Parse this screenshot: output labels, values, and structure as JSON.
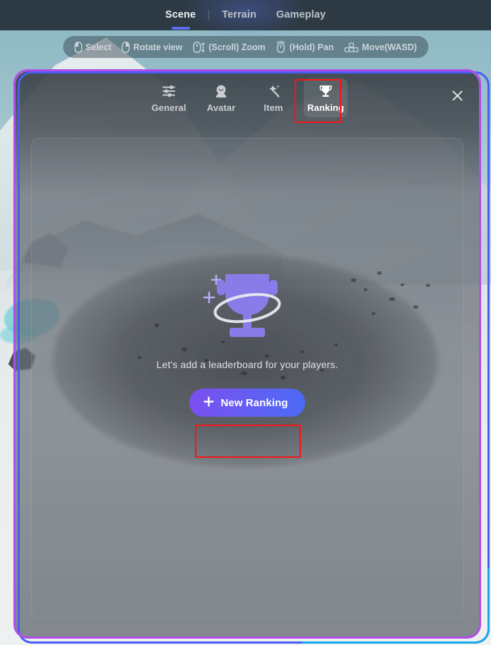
{
  "topnav": {
    "tabs": [
      {
        "label": "Scene",
        "active": true
      },
      {
        "label": "Terrain",
        "active": false
      },
      {
        "label": "Gameplay",
        "active": false
      }
    ],
    "highlighted_tab": "Gameplay"
  },
  "viewport_hints": [
    {
      "icon": "mouse-left-click-icon",
      "label": "Select"
    },
    {
      "icon": "mouse-right-click-icon",
      "label": "Rotate view"
    },
    {
      "icon": "mouse-scroll-icon",
      "label": "(Scroll) Zoom"
    },
    {
      "icon": "mouse-middle-hold-icon",
      "label": "(Hold) Pan"
    },
    {
      "icon": "wasd-keys-icon",
      "label": "Move(WASD)"
    }
  ],
  "modal": {
    "tabs": [
      {
        "label": "General",
        "icon": "sliders-icon",
        "selected": false
      },
      {
        "label": "Avatar",
        "icon": "avatar-head-icon",
        "selected": false
      },
      {
        "label": "Item",
        "icon": "magic-wand-star-icon",
        "selected": false
      },
      {
        "label": "Ranking",
        "icon": "trophy-icon",
        "selected": true
      }
    ],
    "selected_tab": "Ranking",
    "close_icon": "close-icon",
    "empty_state": {
      "illustration": "trophy-sparkle-icon",
      "message": "Let's add a leaderboard for your players.",
      "cta_icon": "plus-icon",
      "cta_label": "New Ranking"
    }
  },
  "colors": {
    "accent_blue": "#5b6ceb",
    "button_gradient_start": "#7b4ff0",
    "button_gradient_end": "#4a6bf5",
    "trophy_purple": "#8a7ce8",
    "highlight_red": "#f41616",
    "outline_purple": "#b24dea",
    "outline_blue": "#4a5cf5",
    "topbar_bg": "#2d3a43"
  }
}
